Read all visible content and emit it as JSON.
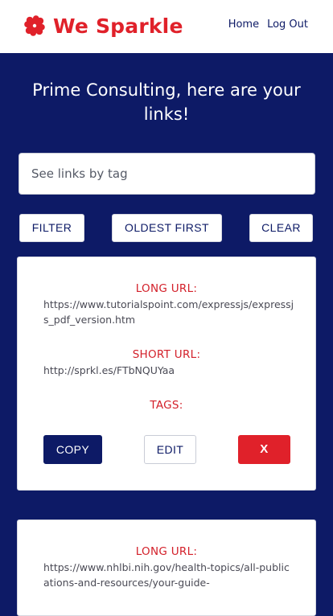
{
  "brand": {
    "name": "We Sparkle",
    "color": "#e0212a"
  },
  "nav": {
    "home": "Home",
    "logout": "Log Out"
  },
  "heading": "Prime Consulting, here are your links!",
  "search": {
    "placeholder": "See links by tag",
    "value": ""
  },
  "controls": {
    "filter": "FILTER",
    "oldest_first": "OLDEST FIRST",
    "clear": "CLEAR"
  },
  "labels": {
    "long_url": "LONG URL:",
    "short_url": "SHORT URL:",
    "tags": "TAGS:"
  },
  "links": [
    {
      "long_url": "https://www.tutorialspoint.com/expressjs/expressjs_pdf_version.htm",
      "short_url": "http://sprkl.es/FTbNQUYaa",
      "tags": "",
      "actions": {
        "copy": "COPY",
        "edit": "EDIT",
        "delete": "X"
      }
    },
    {
      "long_url": "https://www.nhlbi.nih.gov/health-topics/all-publications-and-resources/your-guide-"
    }
  ],
  "colors": {
    "primary": "#0d1a66",
    "accent": "#e0212a",
    "background": "#0d1a66"
  },
  "icons": {
    "logo": "clover-logo-icon"
  }
}
